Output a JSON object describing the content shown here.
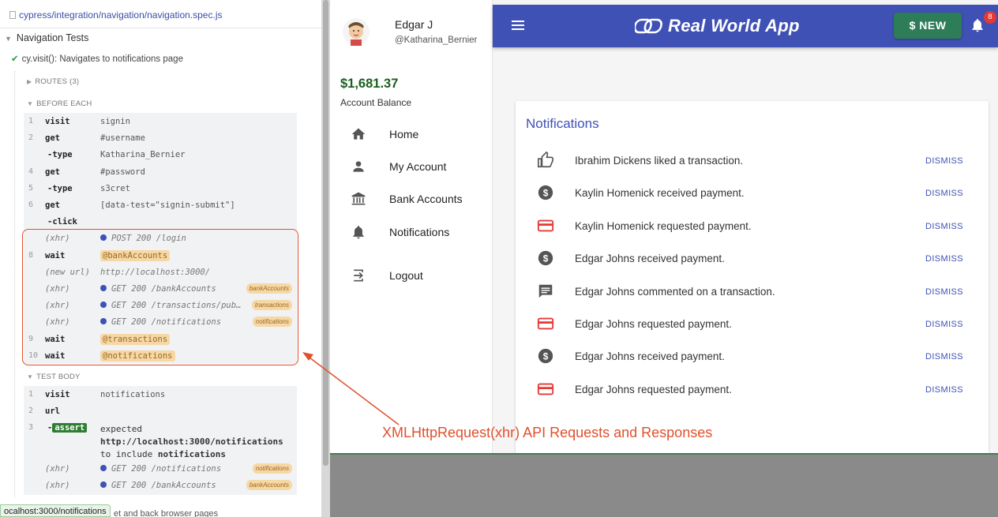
{
  "runner": {
    "spec_path": "cypress/integration/navigation/navigation.spec.js",
    "suite_title": "Navigation Tests",
    "test_title": "cy.visit(): Navigates to notifications page",
    "routes_label": "ROUTES (3)",
    "before_each_label": "BEFORE EACH",
    "test_body_label": "TEST BODY",
    "before_each": [
      {
        "num": "1",
        "name": "visit",
        "msg": "signin"
      },
      {
        "num": "2",
        "name": "get",
        "msg": "#username"
      },
      {
        "num": "",
        "name": "-type",
        "msg": "Katharina_Bernier"
      },
      {
        "num": "4",
        "name": "get",
        "msg": "#password"
      },
      {
        "num": "5",
        "name": "-type",
        "msg": "s3cret"
      },
      {
        "num": "6",
        "name": "get",
        "msg": "[data-test=\"signin-submit\"]"
      },
      {
        "num": "",
        "name": "-click",
        "msg": ""
      },
      {
        "num": "",
        "name": "(xhr)",
        "msg": "POST 200 /login",
        "tag": ""
      },
      {
        "num": "8",
        "name": "wait",
        "alias": "@bankAccounts"
      },
      {
        "num": "",
        "name": "(new url)",
        "msg": "http://localhost:3000/"
      },
      {
        "num": "",
        "name": "(xhr)",
        "msg": "GET 200 /bankAccounts",
        "tag": "bankAccounts"
      },
      {
        "num": "",
        "name": "(xhr)",
        "msg": "GET 200 /transactions/pub…",
        "tag": "transactions"
      },
      {
        "num": "",
        "name": "(xhr)",
        "msg": "GET 200 /notifications",
        "tag": "notifications"
      },
      {
        "num": "9",
        "name": "wait",
        "alias": "@transactions"
      },
      {
        "num": "10",
        "name": "wait",
        "alias": "@notifications"
      }
    ],
    "test_body": {
      "visit": {
        "num": "1",
        "name": "visit",
        "msg": "notifications"
      },
      "url": {
        "num": "2",
        "name": "url"
      },
      "assert": {
        "num": "3",
        "badge": "assert",
        "line1": "expected",
        "line2": "http://localhost:3000/notifications",
        "line3a": "to include ",
        "line3b": "notifications"
      },
      "xhr1": {
        "name": "(xhr)",
        "msg": "GET 200 /notifications",
        "tag": "notifications"
      },
      "xhr2": {
        "name": "(xhr)",
        "msg": "GET 200 /bankAccounts",
        "tag": "bankAccounts"
      }
    },
    "url_bar": "ocalhost:3000/notifications",
    "cut_text": "et and back browser pages"
  },
  "app": {
    "user_name": "Edgar J",
    "user_handle": "@Katharina_Bernier",
    "balance": "$1,681.37",
    "balance_label": "Account Balance",
    "nav": [
      "Home",
      "My Account",
      "Bank Accounts",
      "Notifications",
      "Logout"
    ],
    "brand": "Real World App",
    "new_button": "$ NEW",
    "bell_count": "8",
    "accent": "#3f51b5",
    "notifications_title": "Notifications",
    "dismiss_label": "DISMISS",
    "notifications": [
      {
        "icon": "thumb-up-icon",
        "text": "Ibrahim Dickens liked a transaction."
      },
      {
        "icon": "payment-icon",
        "text": "Kaylin Homenick received payment."
      },
      {
        "icon": "card-icon",
        "text": "Kaylin Homenick requested payment."
      },
      {
        "icon": "payment-icon",
        "text": "Edgar Johns received payment."
      },
      {
        "icon": "comment-icon",
        "text": "Edgar Johns commented on a transaction."
      },
      {
        "icon": "card-icon",
        "text": "Edgar Johns requested payment."
      },
      {
        "icon": "payment-icon",
        "text": "Edgar Johns received payment."
      },
      {
        "icon": "card-icon",
        "text": "Edgar Johns requested payment."
      }
    ]
  },
  "annotation": "XMLHttpRequest(xhr) API Requests and Responses"
}
